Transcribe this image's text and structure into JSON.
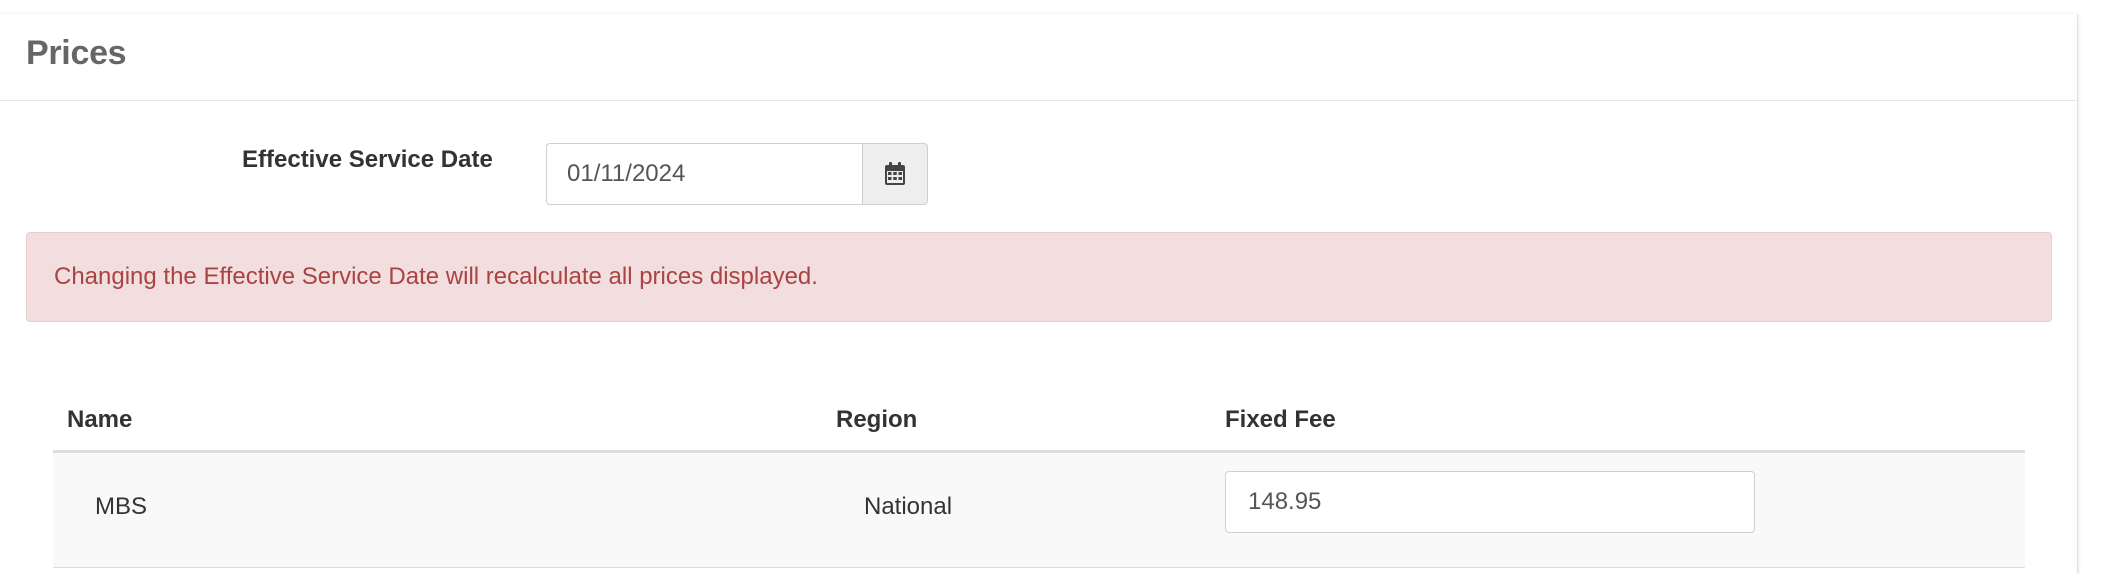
{
  "panel": {
    "title": "Prices"
  },
  "effective_date": {
    "label": "Effective Service Date",
    "value": "01/11/2024",
    "icon": "calendar-icon"
  },
  "alert": {
    "message": "Changing the Effective Service Date will recalculate all prices displayed.",
    "background_color": "#f2dede",
    "text_color": "#a94442"
  },
  "table": {
    "headers": {
      "name": "Name",
      "region": "Region",
      "fixed_fee": "Fixed Fee"
    },
    "rows": [
      {
        "name": "MBS",
        "region": "National",
        "fixed_fee": "148.95"
      }
    ]
  }
}
